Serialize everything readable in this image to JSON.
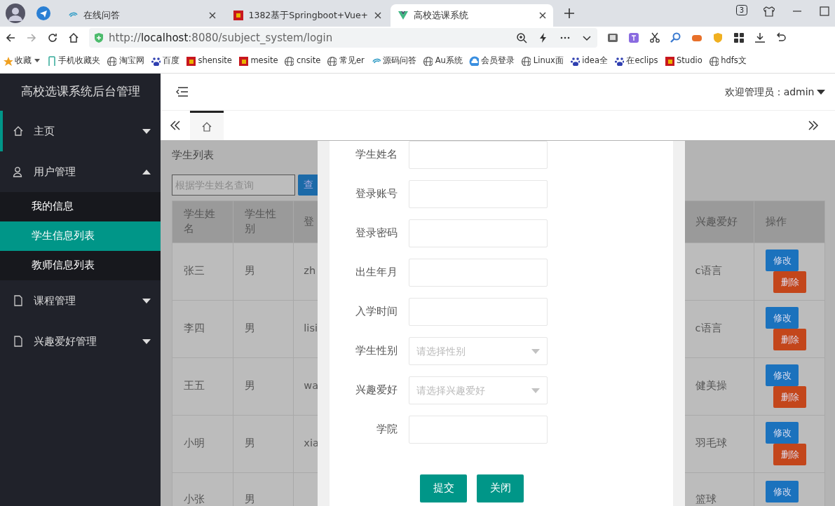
{
  "browser": {
    "tabs": [
      {
        "title": "在线问答",
        "selected": false
      },
      {
        "title": "1382基于Springboot+Vue+",
        "selected": false
      },
      {
        "title": "高校选课系统",
        "selected": true
      }
    ],
    "tab_count": "3",
    "url_host": "localhost",
    "url_prefix": "http://",
    "url_rest": ":8080/subject_system/login",
    "bookmarks": [
      "收藏",
      "手机收藏夹",
      "淘宝网",
      "百度",
      "shensite",
      "mesite",
      "cnsite",
      "常见er",
      "源码问答",
      "Au系统",
      "会员登录",
      "Linux面",
      "idea全",
      "在eclips",
      "Studio",
      "hdfs文"
    ]
  },
  "sidebar": {
    "title": "高校选课系统后台管理",
    "menu": [
      {
        "label": "主页",
        "expanded": false,
        "current": true
      },
      {
        "label": "用户管理",
        "expanded": true,
        "current": false,
        "children": [
          {
            "label": "我的信息",
            "selected": false
          },
          {
            "label": "学生信息列表",
            "selected": true
          },
          {
            "label": "教师信息列表",
            "selected": false
          }
        ]
      },
      {
        "label": "课程管理",
        "expanded": false,
        "current": false
      },
      {
        "label": "兴趣爱好管理",
        "expanded": false,
        "current": false
      }
    ]
  },
  "header": {
    "user": "欢迎管理员：admin"
  },
  "page_title": "学生列表",
  "search": {
    "placeholder": "根据学生姓名查询",
    "button": "查"
  },
  "table": {
    "columns": [
      "学生姓名",
      "学生性别",
      "登",
      "兴趣爱好",
      "操作"
    ],
    "rows": [
      {
        "cells": [
          "张三",
          "男",
          "zh"
        ],
        "hobby": "c语言",
        "actions": [
          {
            "label": "修改",
            "kind": "edit"
          },
          {
            "label": "删除",
            "kind": "delete"
          }
        ]
      },
      {
        "cells": [
          "李四",
          "男",
          "lisi"
        ],
        "hobby": "c语言",
        "actions": [
          {
            "label": "修改",
            "kind": "edit"
          },
          {
            "label": "删除",
            "kind": "delete"
          }
        ]
      },
      {
        "cells": [
          "王五",
          "男",
          "wa"
        ],
        "hobby": "健美操",
        "actions": [
          {
            "label": "修改",
            "kind": "edit"
          },
          {
            "label": "删除",
            "kind": "delete"
          }
        ]
      },
      {
        "cells": [
          "小明",
          "男",
          "xia"
        ],
        "hobby": "羽毛球",
        "actions": [
          {
            "label": "修改",
            "kind": "edit"
          },
          {
            "label": "删除",
            "kind": "delete"
          }
        ]
      },
      {
        "cells": [
          "小张",
          "男"
        ],
        "hobby": "篮球",
        "actions": [
          {
            "label": "修改",
            "kind": "edit"
          }
        ]
      }
    ]
  },
  "modal": {
    "fields": [
      {
        "label": "学生姓名",
        "kind": "text"
      },
      {
        "label": "登录账号",
        "kind": "text"
      },
      {
        "label": "登录密码",
        "kind": "text"
      },
      {
        "label": "出生年月",
        "kind": "text"
      },
      {
        "label": "入学时间",
        "kind": "text"
      },
      {
        "label": "学生性别",
        "kind": "select",
        "placeholder": "请选择性别"
      },
      {
        "label": "兴趣爱好",
        "kind": "select",
        "placeholder": "请选择兴趣爱好"
      },
      {
        "label": "学院",
        "kind": "text"
      }
    ],
    "buttons": [
      "提交",
      "关闭"
    ]
  }
}
